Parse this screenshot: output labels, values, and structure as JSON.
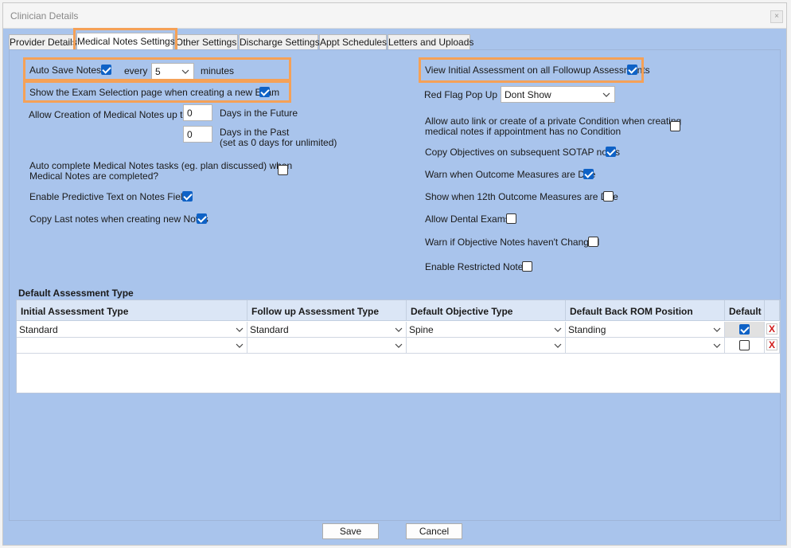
{
  "window": {
    "title": "Clinician Details",
    "close_label": "×"
  },
  "tabs": [
    {
      "label": "Provider Details"
    },
    {
      "label": "Medical Notes Settings"
    },
    {
      "label": "Other Settings"
    },
    {
      "label": "Discharge Settings"
    },
    {
      "label": "Appt Schedules"
    },
    {
      "label": "Letters and Uploads"
    }
  ],
  "active_tab": 1,
  "left": {
    "auto_save_label": "Auto Save Notes",
    "auto_save_checked": true,
    "every_label": "every",
    "every_value": "5",
    "minutes_label": "minutes",
    "show_exam_label": "Show the Exam Selection page when creating a new Exam",
    "show_exam_checked": true,
    "allow_creation_label": "Allow Creation of Medical Notes up to",
    "future_value": "0",
    "future_label": "Days in the Future",
    "past_value": "0",
    "past_label": "Days in the Past",
    "past_hint": "(set as 0 days for unlimited)",
    "auto_complete_line1": "Auto complete Medical Notes tasks (eg. plan discussed) when",
    "auto_complete_line2": "Medical Notes are completed?",
    "auto_complete_checked": false,
    "predictive_label": "Enable Predictive Text on Notes Fields",
    "predictive_checked": true,
    "copy_last_label": "Copy Last notes when creating new Notes",
    "copy_last_checked": true
  },
  "right": {
    "view_initial_label": "View Initial Assessment on all Followup Assessments",
    "view_initial_checked": true,
    "red_flag_label": "Red Flag Pop Up",
    "red_flag_value": "Dont Show",
    "auto_link_line1": "Allow auto link or create of a private Condition when creating",
    "auto_link_line2": "medical notes if appointment has no Condition",
    "auto_link_checked": false,
    "copy_objectives_label": "Copy Objectives on subsequent SOTAP notes",
    "copy_objectives_checked": true,
    "warn_outcome_label": "Warn when Outcome Measures are Due",
    "warn_outcome_checked": true,
    "show_12th_label": "Show when 12th Outcome Measures are Due",
    "show_12th_checked": false,
    "dental_label": "Allow Dental Exams",
    "dental_checked": false,
    "warn_objective_label": "Warn if Objective Notes haven't Changed",
    "warn_objective_checked": false,
    "restricted_label": "Enable Restricted Notes",
    "restricted_checked": false
  },
  "assessment": {
    "section_title": "Default Assessment Type",
    "headers": [
      "Initial Assessment Type",
      "Follow up Assessment Type",
      "Default Objective Type",
      "Default Back ROM Position",
      "Default"
    ],
    "rows": [
      {
        "initial": "Standard",
        "followup": "Standard",
        "objective": "Spine",
        "rom": "Standing",
        "default": true
      },
      {
        "initial": "",
        "followup": "",
        "objective": "",
        "rom": "",
        "default": false
      }
    ],
    "delete_label": "X"
  },
  "buttons": {
    "save": "Save",
    "cancel": "Cancel"
  },
  "colors": {
    "accent": "#0f62c6",
    "highlight": "#f5a157",
    "panel": "#a9c4ec",
    "delete": "#d01c1c"
  }
}
